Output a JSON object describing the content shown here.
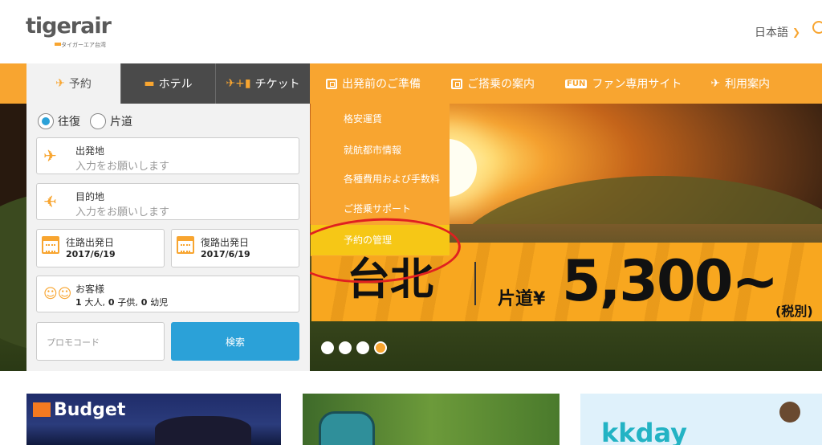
{
  "header": {
    "logo_word": "tigerair",
    "logo_subtitle": "タイガーエア台湾",
    "language": "日本語"
  },
  "booking": {
    "tabs": [
      {
        "label": "予約",
        "icon": "airplane-icon"
      },
      {
        "label": "ホテル",
        "icon": "bed-icon"
      },
      {
        "label": "チケット",
        "icon": "ticket-icon"
      }
    ],
    "trip_types": [
      "往復",
      "片道"
    ],
    "origin": {
      "label": "出発地",
      "placeholder": "入力をお願いします"
    },
    "destination": {
      "label": "目的地",
      "placeholder": "入力をお願いします"
    },
    "departure_date": {
      "label": "往路出発日",
      "value": "2017/6/19"
    },
    "return_date": {
      "label": "復路出発日",
      "value": "2017/6/19"
    },
    "passengers": {
      "label": "お客様",
      "adults": "1",
      "adults_label": "大人,",
      "children": "0",
      "children_label": "子供,",
      "infants": "0",
      "infants_label": "幼児"
    },
    "promo_placeholder": "プロモコード",
    "search_label": "検索"
  },
  "nav": {
    "items": [
      "出発前のご準備",
      "ご搭乗の案内",
      "ファン専用サイト",
      "利用案内"
    ],
    "fan_badge": "FUN"
  },
  "dropdown": {
    "items": [
      "格安運賃",
      "就航都市情報",
      "各種費用および手数料",
      "ご搭乗サポート",
      "予約の管理"
    ]
  },
  "promo": {
    "city": "台北",
    "label": "片道¥",
    "price": "5,300~",
    "tax": "(税別)"
  },
  "cards": [
    {
      "label": "Budget"
    },
    {
      "label": ""
    },
    {
      "label": "kkday"
    }
  ],
  "colors": {
    "brand": "#f8a530",
    "button": "#2ba1d8",
    "highlight": "#f6c716",
    "annotation": "#e02020"
  }
}
